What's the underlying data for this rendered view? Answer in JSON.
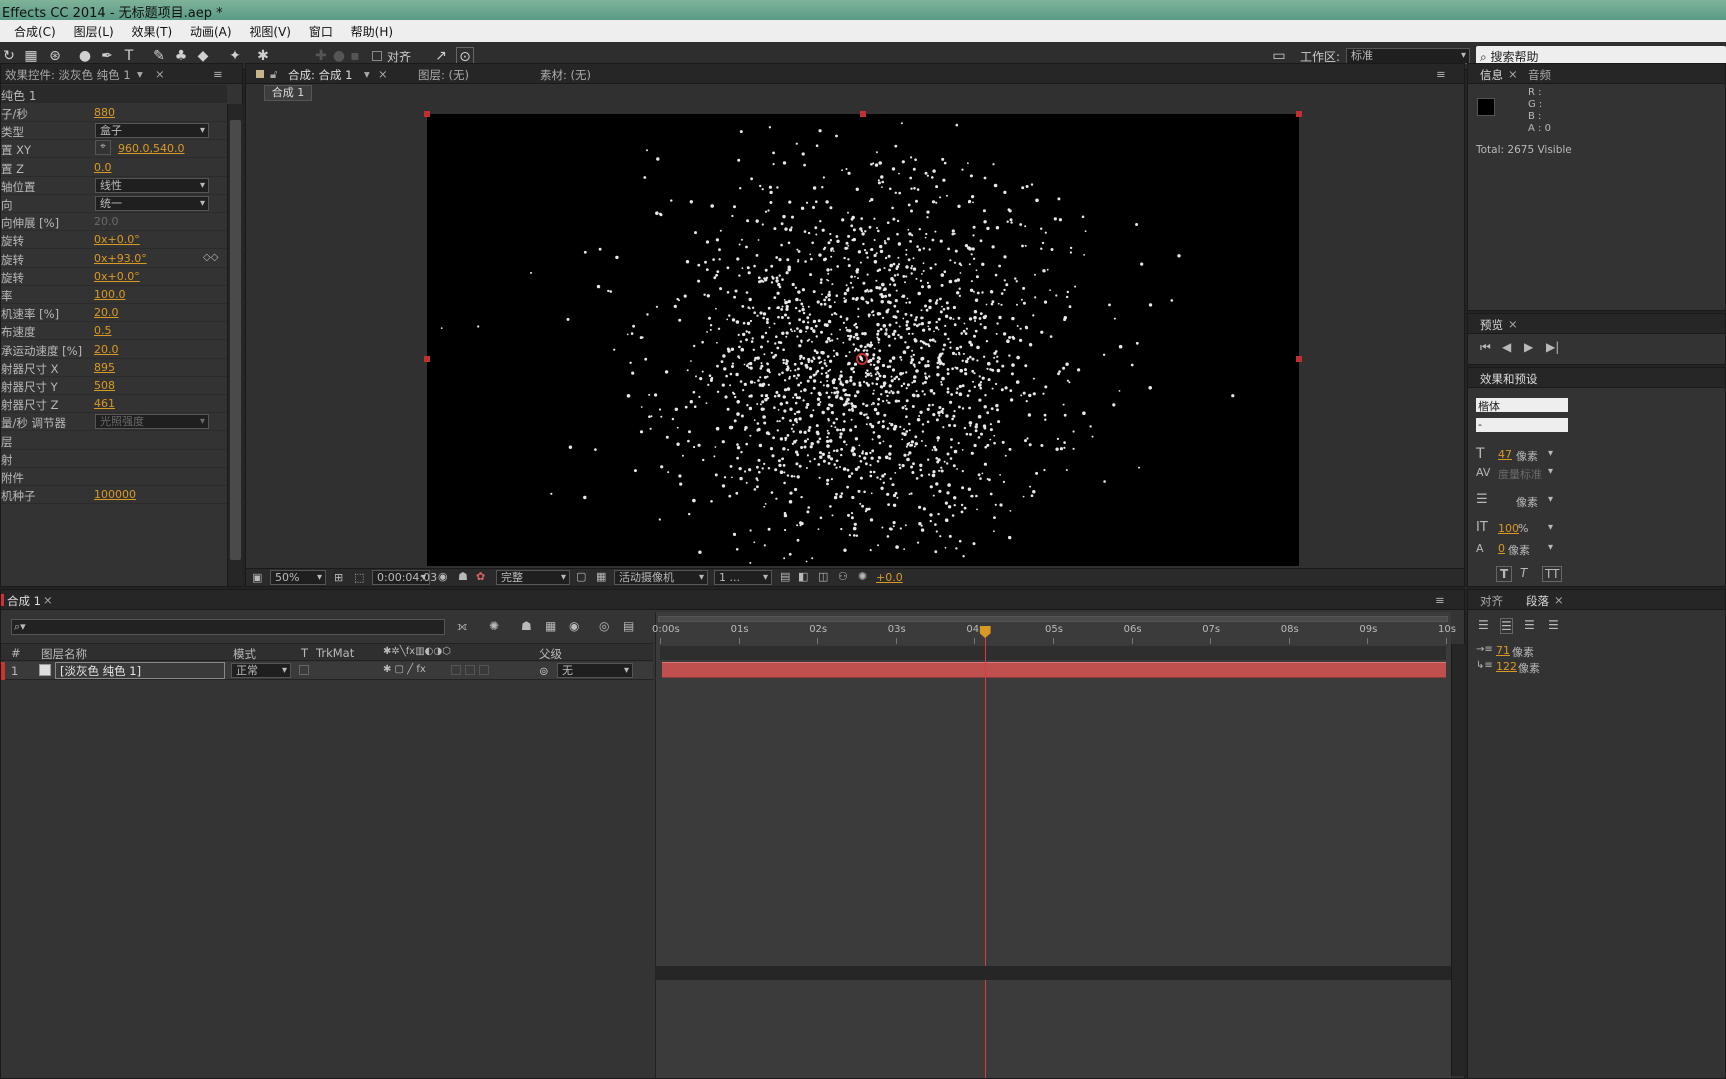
{
  "window": {
    "title": "Effects CC 2014 - 无标题项目.aep *"
  },
  "menu": [
    "合成(C)",
    "图层(L)",
    "效果(T)",
    "动画(A)",
    "视图(V)",
    "窗口",
    "帮助(H)"
  ],
  "toolbar": {
    "snap_label": "对齐",
    "workspace_label": "工作区:",
    "workspace_value": "标准",
    "search_help": "搜索帮助"
  },
  "effect_controls": {
    "tab": "效果控件: 淡灰色 纯色 1",
    "header": "纯色 1",
    "rows": [
      {
        "label": "子/秒",
        "value": "880"
      },
      {
        "label": "类型",
        "value": "盒子"
      },
      {
        "label": "置 XY",
        "value": "960.0,540.0"
      },
      {
        "label": "置 Z",
        "value": "0.0"
      },
      {
        "label": "轴位置",
        "value": "线性"
      },
      {
        "label": "向",
        "value": "统一"
      },
      {
        "label": "向伸展 [%]",
        "value": "20.0"
      },
      {
        "label": "旋转",
        "value": "0x+0.0°"
      },
      {
        "label": "旋转",
        "value": "0x+93.0°"
      },
      {
        "label": "旋转",
        "value": "0x+0.0°"
      },
      {
        "label": "率",
        "value": "100.0"
      },
      {
        "label": "机速率 [%]",
        "value": "20.0"
      },
      {
        "label": "布速度",
        "value": "0.5"
      },
      {
        "label": "承运动速度 [%]",
        "value": "20.0"
      },
      {
        "label": "射器尺寸 X",
        "value": "895"
      },
      {
        "label": "射器尺寸 Y",
        "value": "508"
      },
      {
        "label": "射器尺寸 Z",
        "value": "461"
      },
      {
        "label": "量/秒 调节器",
        "value": "光照强度"
      },
      {
        "label": "层",
        "value": ""
      },
      {
        "label": "射",
        "value": ""
      },
      {
        "label": "附件",
        "value": ""
      },
      {
        "label": "机种子",
        "value": "100000"
      }
    ]
  },
  "composition": {
    "tab": "合成: 合成 1",
    "layer_tab": "图层: (无)",
    "footage_tab": "素材: (无)",
    "subtab": "合成 1",
    "footer": {
      "zoom": "50%",
      "timecode": "0:00:04:03",
      "quality": "完整",
      "camera": "活动摄像机",
      "views": "1 ...",
      "exposure": "+0.0"
    }
  },
  "info": {
    "tab_info": "信息",
    "tab_audio": "音频",
    "r": "R :",
    "g": "G :",
    "b": "B :",
    "a": "A : 0",
    "total": "Total: 2675   Visible"
  },
  "preview": {
    "tab": "预览"
  },
  "effects_presets": {
    "tab": "效果和预设",
    "font": "楷体",
    "style": "-",
    "size": "47",
    "size_unit": "像素",
    "tracking_label": "度量标准",
    "leading_unit": "像素",
    "vscale": "100",
    "vscale_unit": "%",
    "baseline": "0",
    "baseline_unit": "像素"
  },
  "paragraph": {
    "tab_align": "对齐",
    "tab_paragraph": "段落",
    "indent1": "71",
    "indent1_unit": "像素",
    "indent2": "122",
    "indent2_unit": "像素"
  },
  "timeline": {
    "tab": "合成 1",
    "columns": {
      "num": "#",
      "name": "图层名称",
      "mode": "模式",
      "t": "T",
      "trkmat": "TrkMat",
      "parent": "父级"
    },
    "layer": {
      "num": "1",
      "name": "[淡灰色 纯色 1]",
      "mode": "正常",
      "parent": "无"
    },
    "ticks": [
      "0:00s",
      "01s",
      "02s",
      "03s",
      "04s",
      "05s",
      "06s",
      "07s",
      "08s",
      "09s",
      "10s"
    ],
    "current_time_s": 4.13
  },
  "colors": {
    "accent": "#d99a25",
    "layer_bar": "#c0504d",
    "playhead": "#e03b3b",
    "handle": "#c03030"
  }
}
